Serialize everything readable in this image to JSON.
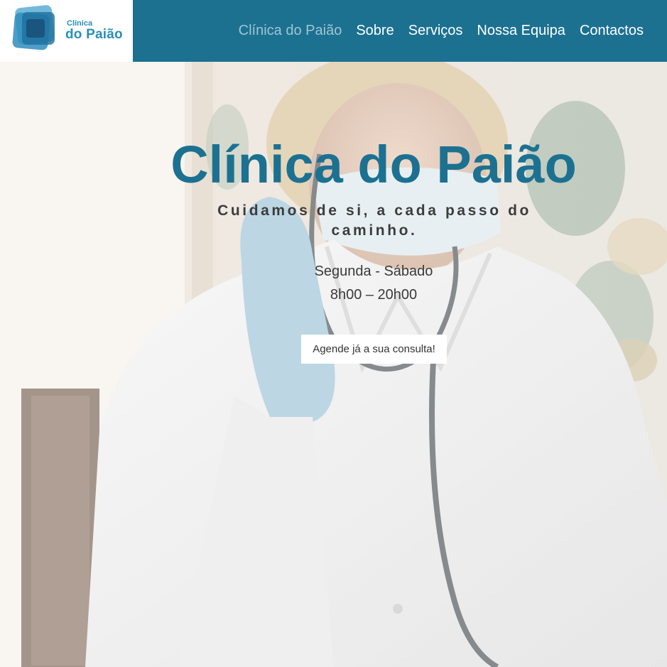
{
  "logo": {
    "line1": "Clínica",
    "line2": "do Paião",
    "icon": "logo-squares-icon"
  },
  "nav": {
    "items": [
      {
        "label": "Clínica do Paião",
        "active": true
      },
      {
        "label": "Sobre",
        "active": false
      },
      {
        "label": "Serviços",
        "active": false
      },
      {
        "label": "Nossa Equipa",
        "active": false
      },
      {
        "label": "Contactos",
        "active": false
      }
    ]
  },
  "hero": {
    "title": "Clínica do Paião",
    "tagline": "Cuidamos de si, a cada passo do caminho.",
    "hours_days": "Segunda - Sábado",
    "hours_time": "8h00 – 20h00",
    "cta_label": "Agende já a sua consulta!"
  },
  "colors": {
    "brand": "#1c7191",
    "logo_blue": "#2a8fb8",
    "nav_active": "#9fc4d3",
    "text_dark": "#3c3c3c"
  }
}
